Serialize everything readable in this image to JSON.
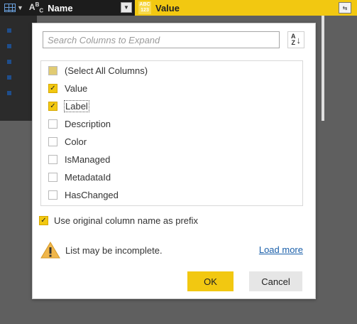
{
  "header": {
    "col1_type_icon": "ABC",
    "col1_name": "Name",
    "col2_type_icon": "ABC 123",
    "col2_name": "Value",
    "filter_icon": "chevron-down-icon",
    "expand_icon": "expand-columns-icon"
  },
  "panel": {
    "search": {
      "placeholder": "Search Columns to Expand",
      "value": ""
    },
    "sort_icon": "sort-az-icon",
    "items": [
      {
        "label": "(Select All Columns)",
        "state": "partial"
      },
      {
        "label": "Value",
        "state": "checked"
      },
      {
        "label": "Label",
        "state": "checked"
      },
      {
        "label": "Description",
        "state": "unchecked"
      },
      {
        "label": "Color",
        "state": "unchecked"
      },
      {
        "label": "IsManaged",
        "state": "unchecked"
      },
      {
        "label": "MetadataId",
        "state": "unchecked"
      },
      {
        "label": "HasChanged",
        "state": "unchecked"
      }
    ],
    "prefix_option": {
      "label": "Use original column name as prefix",
      "checked": true
    },
    "warning": {
      "text": "List may be incomplete.",
      "link": "Load more"
    },
    "buttons": {
      "ok": "OK",
      "cancel": "Cancel"
    }
  },
  "colors": {
    "accent": "#f2c811",
    "link": "#1a5faa",
    "header_dark": "#1c1c1c"
  }
}
